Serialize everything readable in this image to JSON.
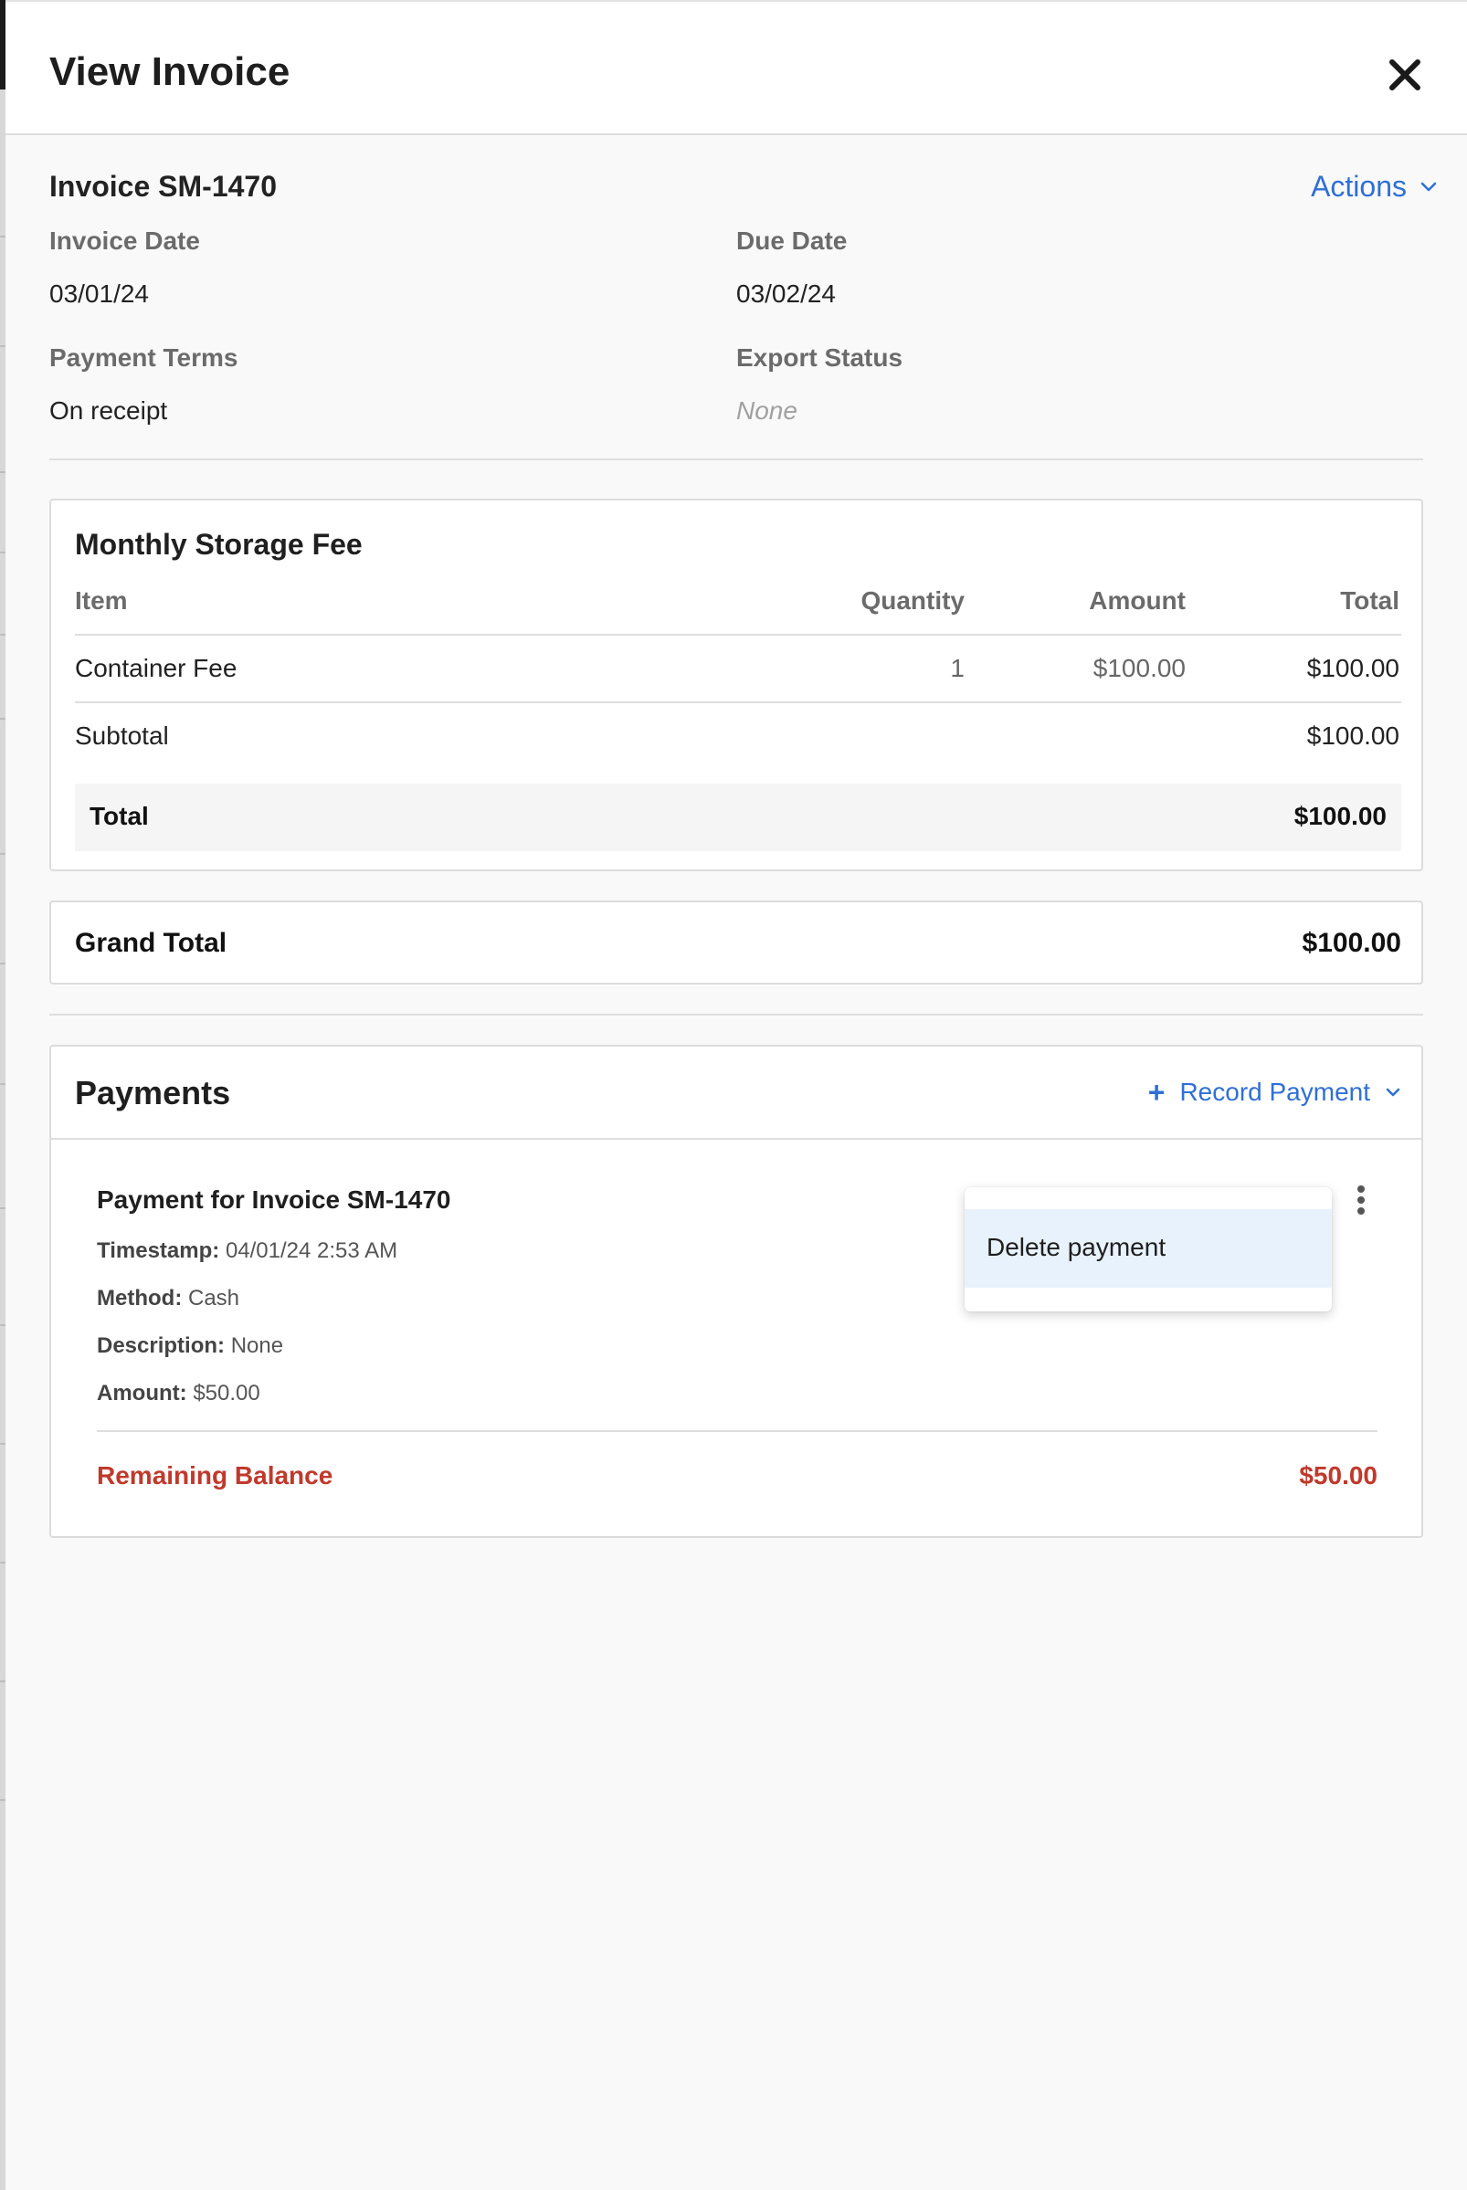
{
  "header": {
    "title": "View Invoice"
  },
  "invoice": {
    "number_label": "Invoice SM-1470",
    "actions_label": "Actions",
    "fields": {
      "invoice_date_label": "Invoice Date",
      "invoice_date": "03/01/24",
      "due_date_label": "Due Date",
      "due_date": "03/02/24",
      "payment_terms_label": "Payment Terms",
      "payment_terms": "On receipt",
      "export_status_label": "Export Status",
      "export_status": "None"
    }
  },
  "items": {
    "title": "Monthly Storage Fee",
    "columns": {
      "item": "Item",
      "quantity": "Quantity",
      "amount": "Amount",
      "total": "Total"
    },
    "rows": [
      {
        "item": "Container Fee",
        "quantity": "1",
        "amount": "$100.00",
        "total": "$100.00"
      }
    ],
    "subtotal_label": "Subtotal",
    "subtotal": "$100.00",
    "total_label": "Total",
    "total": "$100.00"
  },
  "grand_total": {
    "label": "Grand Total",
    "value": "$100.00"
  },
  "payments": {
    "title": "Payments",
    "record_label": "Record Payment",
    "entry": {
      "title": "Payment for Invoice SM-1470",
      "timestamp_label": "Timestamp:",
      "timestamp": "04/01/24 2:53 AM",
      "method_label": "Method:",
      "method": "Cash",
      "description_label": "Description:",
      "description": "None",
      "amount_label": "Amount:",
      "amount": "$50.00"
    },
    "remaining_label": "Remaining Balance",
    "remaining_value": "$50.00"
  },
  "menu": {
    "delete_label": "Delete payment"
  },
  "colors": {
    "accent": "#2f6fd6",
    "danger": "#c0392b",
    "menu_highlight": "#e8f2fc"
  },
  "icons": {
    "close": "close-icon",
    "actions": "chevron-down-icon",
    "kebab": "more-vertical-icon",
    "add": "plus-icon"
  }
}
